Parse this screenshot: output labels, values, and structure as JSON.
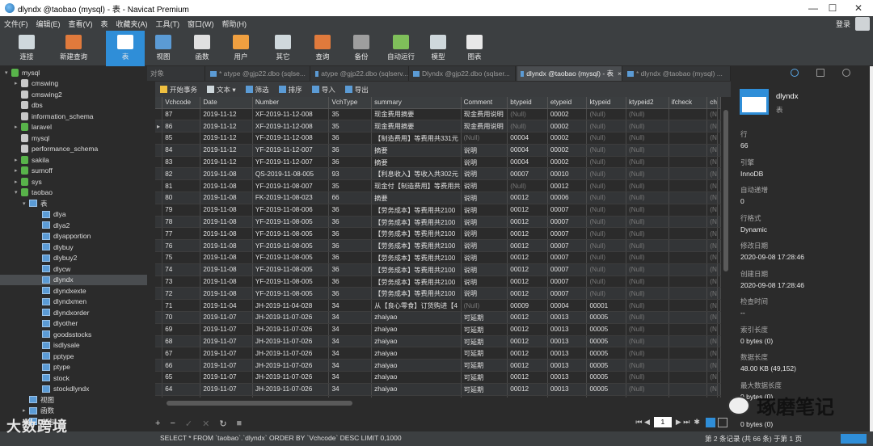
{
  "window": {
    "title": "dlyndx @taobao (mysql) - 表 - Navicat Premium"
  },
  "menu": [
    "文件(F)",
    "编辑(E)",
    "查看(V)",
    "表",
    "收藏夹(A)",
    "工具(T)",
    "窗口(W)",
    "帮助(H)"
  ],
  "login_label": "登录",
  "toolbar": [
    {
      "label": "连接",
      "icon": "plug-icon"
    },
    {
      "label": "新建查询",
      "icon": "new-query-icon"
    },
    {
      "label": "表",
      "icon": "table-icon",
      "active": true
    },
    {
      "label": "视图",
      "icon": "view-icon"
    },
    {
      "label": "函数",
      "icon": "function-icon"
    },
    {
      "label": "用户",
      "icon": "user-icon"
    },
    {
      "label": "其它",
      "icon": "tools-icon"
    },
    {
      "label": "查询",
      "icon": "query-icon"
    },
    {
      "label": "备份",
      "icon": "backup-icon"
    },
    {
      "label": "自动运行",
      "icon": "schedule-icon"
    },
    {
      "label": "模型",
      "icon": "model-icon"
    },
    {
      "label": "图表",
      "icon": "chart-icon"
    }
  ],
  "tree": [
    {
      "label": "mysql",
      "type": "conn",
      "arrow": "▾"
    },
    {
      "label": "cmswing",
      "type": "db",
      "arrow": "▸"
    },
    {
      "label": "cmswing2",
      "type": "db",
      "arrow": ""
    },
    {
      "label": "dbs",
      "type": "db",
      "arrow": ""
    },
    {
      "label": "information_schema",
      "type": "db",
      "arrow": ""
    },
    {
      "label": "laravel",
      "type": "db-green",
      "arrow": "▸"
    },
    {
      "label": "mysql",
      "type": "db",
      "arrow": ""
    },
    {
      "label": "performance_schema",
      "type": "db",
      "arrow": ""
    },
    {
      "label": "sakila",
      "type": "db-green",
      "arrow": "▸"
    },
    {
      "label": "surnoff",
      "type": "db-green",
      "arrow": "▸"
    },
    {
      "label": "sys",
      "type": "db-green",
      "arrow": "▸"
    },
    {
      "label": "taobao",
      "type": "db-green",
      "arrow": "▾"
    },
    {
      "label": "表",
      "type": "folder",
      "arrow": "▾"
    },
    {
      "label": "dlya",
      "type": "table",
      "arrow": ""
    },
    {
      "label": "dlya2",
      "type": "table",
      "arrow": ""
    },
    {
      "label": "dlyapportion",
      "type": "table",
      "arrow": ""
    },
    {
      "label": "dlybuy",
      "type": "table",
      "arrow": ""
    },
    {
      "label": "dlybuy2",
      "type": "table",
      "arrow": ""
    },
    {
      "label": "dlycw",
      "type": "table",
      "arrow": ""
    },
    {
      "label": "dlyndx",
      "type": "table",
      "arrow": "",
      "selected": true
    },
    {
      "label": "dlyndxexte",
      "type": "table",
      "arrow": ""
    },
    {
      "label": "dlyndxmen",
      "type": "table",
      "arrow": ""
    },
    {
      "label": "dlyndxorder",
      "type": "table",
      "arrow": ""
    },
    {
      "label": "dlyother",
      "type": "table",
      "arrow": ""
    },
    {
      "label": "goodsstocks",
      "type": "table",
      "arrow": ""
    },
    {
      "label": "isdlysale",
      "type": "table",
      "arrow": ""
    },
    {
      "label": "pptype",
      "type": "table",
      "arrow": ""
    },
    {
      "label": "ptype",
      "type": "table",
      "arrow": ""
    },
    {
      "label": "stock",
      "type": "table",
      "arrow": ""
    },
    {
      "label": "stockdlyndx",
      "type": "table",
      "arrow": ""
    },
    {
      "label": "视图",
      "type": "folder",
      "arrow": ""
    },
    {
      "label": "函数",
      "type": "folder",
      "arrow": "▸"
    },
    {
      "label": "查询",
      "type": "folder",
      "arrow": "▸"
    }
  ],
  "tabs": [
    {
      "label": "对象",
      "active": false
    },
    {
      "label": "* atype @gjp22.dbo (sqlse...",
      "active": false
    },
    {
      "label": "atype @gjp22.dbo (sqlserv...",
      "active": false
    },
    {
      "label": "Dlyndx @gjp22.dbo (sqlser...",
      "active": false
    },
    {
      "label": "dlyndx @taobao (mysql) - 表",
      "active": true
    },
    {
      "label": "* dlyndx @taobao (mysql) ...",
      "active": false
    }
  ],
  "objbar": [
    {
      "label": "开始事务",
      "icon": "transaction-icon"
    },
    {
      "label": "文本 ▾",
      "icon": "text-icon"
    },
    {
      "label": "筛选",
      "icon": "filter-icon"
    },
    {
      "label": "排序",
      "icon": "sort-icon"
    },
    {
      "label": "导入",
      "icon": "import-icon"
    },
    {
      "label": "导出",
      "icon": "export-icon"
    }
  ],
  "grid": {
    "columns": [
      "Vchcode",
      "Date",
      "Number",
      "VchType",
      "summary",
      "Comment",
      "btypeid",
      "etypeid",
      "ktypeid",
      "ktypeid2",
      "ifcheck",
      "ch"
    ],
    "rows": [
      [
        "87",
        "2019-11-12",
        "XF-2019-11-12-008",
        "35",
        "现金费用摘要",
        "现金费用说明",
        "(Null)",
        "00002",
        "(Null)",
        "(Null)",
        "",
        "(N"
      ],
      [
        "86",
        "2019-11-12",
        "XF-2019-11-12-008",
        "35",
        "现金费用摘要",
        "现金费用说明",
        "(Null)",
        "00002",
        "(Null)",
        "(Null)",
        "",
        "(N"
      ],
      [
        "85",
        "2019-11-12",
        "YF-2019-11-12-008",
        "36",
        "【制造费用】等费用共331元",
        "(Null)",
        "00004",
        "00002",
        "(Null)",
        "(Null)",
        "",
        "(N"
      ],
      [
        "84",
        "2019-11-12",
        "YF-2019-11-12-007",
        "36",
        "摘要",
        "说明",
        "00004",
        "00002",
        "(Null)",
        "(Null)",
        "",
        "(N"
      ],
      [
        "83",
        "2019-11-12",
        "YF-2019-11-12-007",
        "36",
        "摘要",
        "说明",
        "00004",
        "00002",
        "(Null)",
        "(Null)",
        "",
        "(N"
      ],
      [
        "82",
        "2019-11-08",
        "QS-2019-11-08-005",
        "93",
        "【利息收入】等收入共302元",
        "说明",
        "00007",
        "00010",
        "(Null)",
        "(Null)",
        "",
        "(N"
      ],
      [
        "81",
        "2019-11-08",
        "YF-2019-11-08-007",
        "35",
        "现金付【制造费用】等费用共",
        "说明",
        "(Null)",
        "00012",
        "(Null)",
        "(Null)",
        "",
        "(N"
      ],
      [
        "80",
        "2019-11-08",
        "FK-2019-11-08-023",
        "66",
        "摘要",
        "说明",
        "00012",
        "00006",
        "(Null)",
        "(Null)",
        "",
        "(N"
      ],
      [
        "79",
        "2019-11-08",
        "YF-2019-11-08-006",
        "36",
        "【劳务成本】等费用共2100",
        "说明",
        "00012",
        "00007",
        "(Null)",
        "(Null)",
        "",
        "(N"
      ],
      [
        "78",
        "2019-11-08",
        "YF-2019-11-08-005",
        "36",
        "【劳务成本】等费用共2100",
        "说明",
        "00012",
        "00007",
        "(Null)",
        "(Null)",
        "",
        "(N"
      ],
      [
        "77",
        "2019-11-08",
        "YF-2019-11-08-005",
        "36",
        "【劳务成本】等费用共2100",
        "说明",
        "00012",
        "00007",
        "(Null)",
        "(Null)",
        "",
        "(N"
      ],
      [
        "76",
        "2019-11-08",
        "YF-2019-11-08-005",
        "36",
        "【劳务成本】等费用共2100",
        "说明",
        "00012",
        "00007",
        "(Null)",
        "(Null)",
        "",
        "(N"
      ],
      [
        "75",
        "2019-11-08",
        "YF-2019-11-08-005",
        "36",
        "【劳务成本】等费用共2100",
        "说明",
        "00012",
        "00007",
        "(Null)",
        "(Null)",
        "",
        "(N"
      ],
      [
        "74",
        "2019-11-08",
        "YF-2019-11-08-005",
        "36",
        "【劳务成本】等费用共2100",
        "说明",
        "00012",
        "00007",
        "(Null)",
        "(Null)",
        "",
        "(N"
      ],
      [
        "73",
        "2019-11-08",
        "YF-2019-11-08-005",
        "36",
        "【劳务成本】等费用共2100",
        "说明",
        "00012",
        "00007",
        "(Null)",
        "(Null)",
        "",
        "(N"
      ],
      [
        "72",
        "2019-11-08",
        "YF-2019-11-08-005",
        "36",
        "【劳务成本】等费用共2100",
        "说明",
        "00012",
        "00007",
        "(Null)",
        "(Null)",
        "",
        "(N"
      ],
      [
        "71",
        "2019-11-04",
        "JH-2019-11-04-028",
        "34",
        "从【良心零食】订货购进【4",
        "(Null)",
        "00009",
        "00004",
        "00001",
        "(Null)",
        "",
        "(N"
      ],
      [
        "70",
        "2019-11-07",
        "JH-2019-11-07-026",
        "34",
        "zhaiyao",
        "可延期",
        "00012",
        "00013",
        "00005",
        "(Null)",
        "",
        "(N"
      ],
      [
        "69",
        "2019-11-07",
        "JH-2019-11-07-026",
        "34",
        "zhaiyao",
        "可延期",
        "00012",
        "00013",
        "00005",
        "(Null)",
        "",
        "(N"
      ],
      [
        "68",
        "2019-11-07",
        "JH-2019-11-07-026",
        "34",
        "zhaiyao",
        "可延期",
        "00012",
        "00013",
        "00005",
        "(Null)",
        "",
        "(N"
      ],
      [
        "67",
        "2019-11-07",
        "JH-2019-11-07-026",
        "34",
        "zhaiyao",
        "可延期",
        "00012",
        "00013",
        "00005",
        "(Null)",
        "",
        "(N"
      ],
      [
        "66",
        "2019-11-07",
        "JH-2019-11-07-026",
        "34",
        "zhaiyao",
        "可延期",
        "00012",
        "00013",
        "00005",
        "(Null)",
        "",
        "(N"
      ],
      [
        "65",
        "2019-11-07",
        "JH-2019-11-07-026",
        "34",
        "zhaiyao",
        "可延期",
        "00012",
        "00013",
        "00005",
        "(Null)",
        "",
        "(N"
      ],
      [
        "64",
        "2019-11-07",
        "JH-2019-11-07-026",
        "34",
        "zhaiyao",
        "可延期",
        "00012",
        "00013",
        "00005",
        "(Null)",
        "",
        "(N"
      ],
      [
        "63",
        "2019-11-07",
        "JH-2019-11-07-026",
        "34",
        "zhaiyao",
        "可延期",
        "00012",
        "00013",
        "00005",
        "(Null)",
        "",
        "(N"
      ]
    ]
  },
  "nav": {
    "page": "1"
  },
  "status": {
    "sql": "SELECT * FROM `taobao`.`dlyndx` ORDER BY `Vchcode` DESC LIMIT 0,1000",
    "record": "第 2 条记录 (共 66 条) 于第 1 页"
  },
  "panel": {
    "name": "dlyndx",
    "type": "表",
    "props": [
      {
        "label": "行",
        "value": "66"
      },
      {
        "label": "引擎",
        "value": "InnoDB"
      },
      {
        "label": "自动递增",
        "value": "0"
      },
      {
        "label": "行格式",
        "value": "Dynamic"
      },
      {
        "label": "修改日期",
        "value": "2020-09-08 17:28:46"
      },
      {
        "label": "创建日期",
        "value": "2020-09-08 17:28:46"
      },
      {
        "label": "检查时间",
        "value": "--"
      },
      {
        "label": "索引长度",
        "value": "0 bytes (0)"
      },
      {
        "label": "数据长度",
        "value": "48.00 KB (49,152)"
      },
      {
        "label": "最大数据长度",
        "value": "0 bytes (0)"
      },
      {
        "label": "",
        "value": "0 bytes (0)"
      }
    ]
  },
  "watermark_left": "大数跨境",
  "watermark_right": "琢磨笔记"
}
